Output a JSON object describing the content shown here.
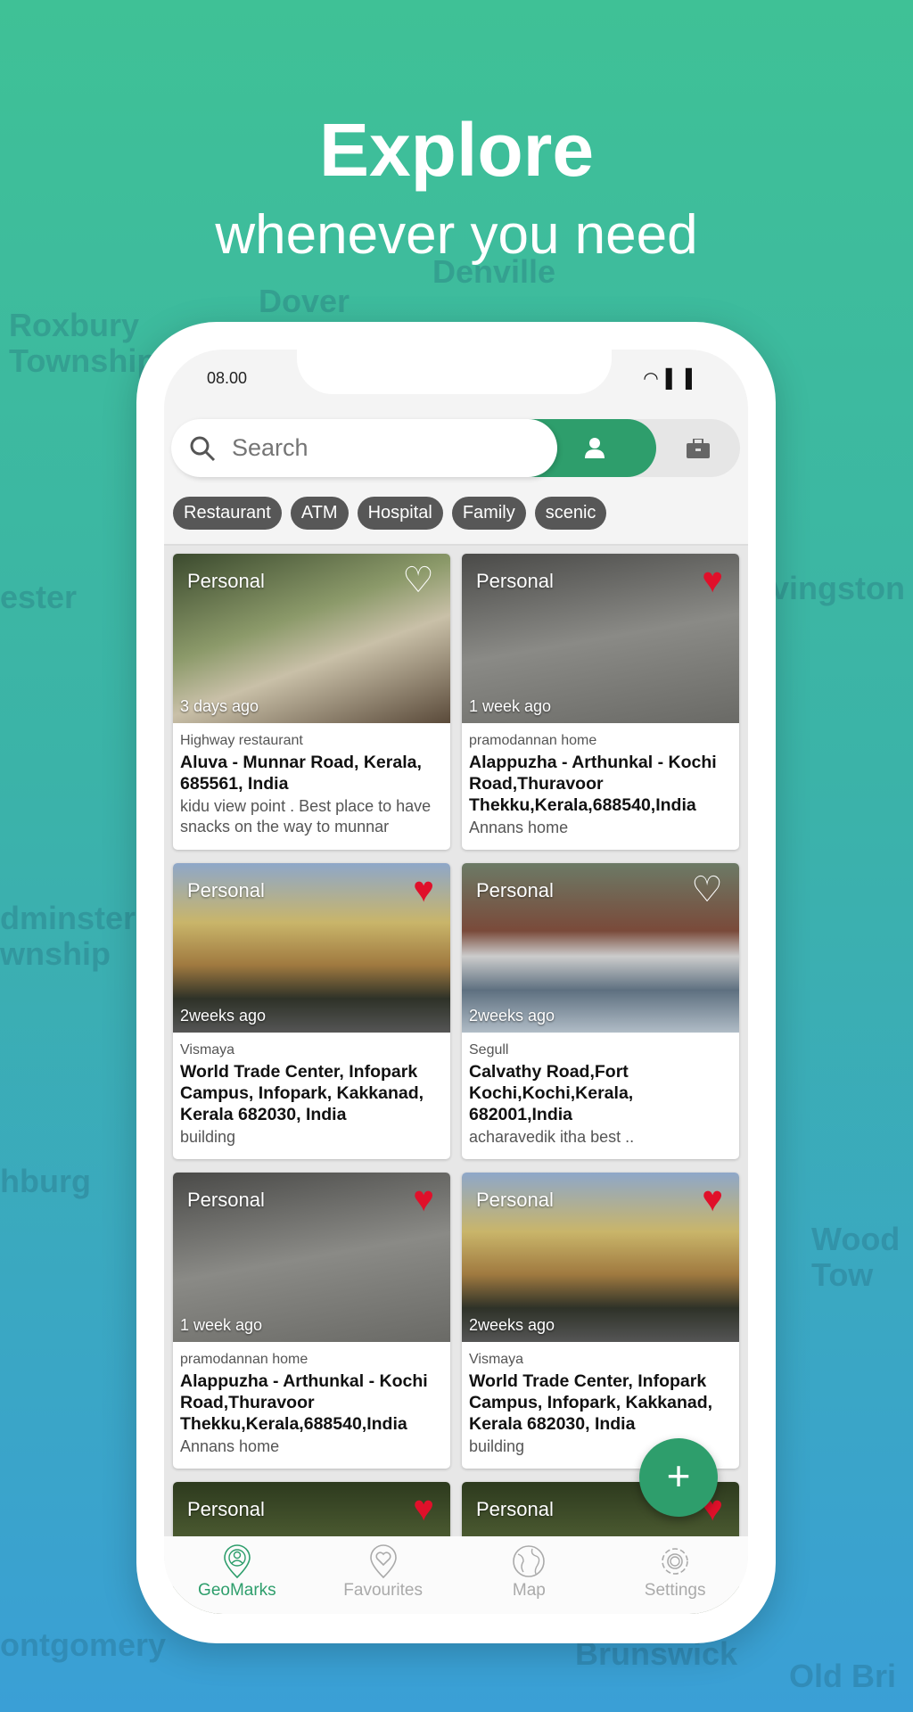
{
  "map_labels": [
    "Dover",
    "Denville",
    "Roxbury\nTownship",
    "ester",
    "vingston",
    "dminster\nwnship",
    "hburg",
    "Wood\nTow",
    "ontgomery",
    "Brunswick",
    "Old Bri"
  ],
  "header": {
    "title": "Explore",
    "subtitle": "whenever you need"
  },
  "status": {
    "time": "08.00"
  },
  "search": {
    "placeholder": "Search"
  },
  "colors": {
    "accent": "#2e9e6c",
    "heart": "#e0102a",
    "chip": "#575757"
  },
  "chips": [
    "Restaurant",
    "ATM",
    "Hospital",
    "Family",
    "scenic"
  ],
  "cards": [
    {
      "tag": "Personal",
      "ago": "3 days ago",
      "favorite": false,
      "category": "Highway restaurant",
      "address": "Aluva - Munnar Road, Kerala, 685561, India",
      "description": "kidu view point . Best place to have snacks on the way to munnar"
    },
    {
      "tag": "Personal",
      "ago": "1 week ago",
      "favorite": true,
      "category": "pramodannan home",
      "address": "Alappuzha - Arthunkal - Kochi Road,Thuravoor Thekku,Kerala,688540,India",
      "description": "Annans  home"
    },
    {
      "tag": "Personal",
      "ago": "2weeks ago",
      "favorite": true,
      "category": "Vismaya",
      "address": "World Trade Center, Infopark Campus, Infopark, Kakkanad, Kerala 682030, India",
      "description": "building"
    },
    {
      "tag": "Personal",
      "ago": "2weeks ago",
      "favorite": false,
      "category": "Segull",
      "address": "Calvathy Road,Fort Kochi,Kochi,Kerala, 682001,India",
      "description": "acharavedik itha best .."
    },
    {
      "tag": "Personal",
      "ago": "1 week ago",
      "favorite": true,
      "category": "pramodannan home",
      "address": "Alappuzha - Arthunkal - Kochi Road,Thuravoor Thekku,Kerala,688540,India",
      "description": "Annans  home"
    },
    {
      "tag": "Personal",
      "ago": "2weeks ago",
      "favorite": true,
      "category": "Vismaya",
      "address": "World Trade Center, Infopark Campus, Infopark, Kakkanad, Kerala 682030, India",
      "description": "building"
    },
    {
      "tag": "Personal",
      "favorite": true
    },
    {
      "tag": "Personal",
      "favorite": true
    }
  ],
  "nav": [
    {
      "label": "GeoMarks",
      "icon": "geomarks-pin-icon",
      "active": true
    },
    {
      "label": "Favourites",
      "icon": "heart-pin-icon"
    },
    {
      "label": "Map",
      "icon": "globe-icon"
    },
    {
      "label": "Settings",
      "icon": "gear-icon"
    }
  ],
  "fab": {
    "label": "+"
  }
}
